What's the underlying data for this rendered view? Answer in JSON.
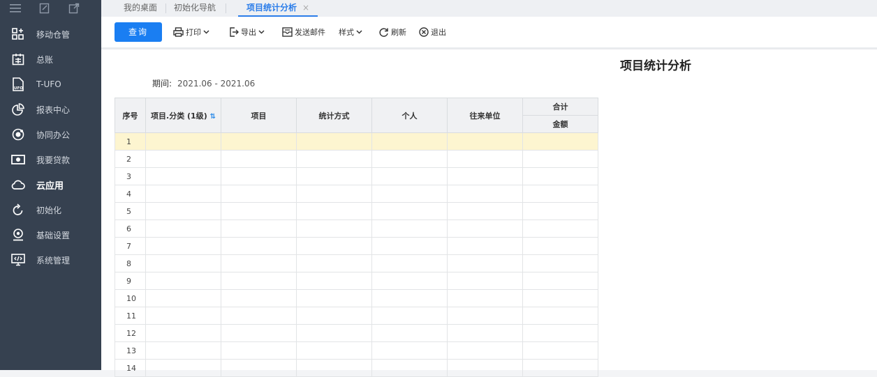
{
  "sidebar": {
    "top_icons": [
      "menu-icon",
      "compose-icon",
      "external-icon"
    ],
    "items": [
      {
        "label": "移动仓管",
        "icon": "warehouse-icon",
        "active": false
      },
      {
        "label": "总账",
        "icon": "ledger-icon",
        "active": false
      },
      {
        "label": "T-UFO",
        "icon": "ufo-file-icon",
        "active": false
      },
      {
        "label": "报表中心",
        "icon": "pie-chart-icon",
        "active": false
      },
      {
        "label": "协同办公",
        "icon": "collaboration-icon",
        "active": false
      },
      {
        "label": "我要贷款",
        "icon": "money-icon",
        "active": false
      },
      {
        "label": "云应用",
        "icon": "cloud-icon",
        "active": true
      },
      {
        "label": "初始化",
        "icon": "refresh-icon",
        "active": false
      },
      {
        "label": "基础设置",
        "icon": "settings-user-icon",
        "active": false
      },
      {
        "label": "系统管理",
        "icon": "system-monitor-icon",
        "active": false
      }
    ]
  },
  "tabs": [
    {
      "label": "我的桌面",
      "active": false
    },
    {
      "label": "初始化导航",
      "active": false
    },
    {
      "label": "项目统计分析",
      "active": true,
      "close": "×"
    }
  ],
  "toolbar": {
    "query": "查询",
    "print": "打印",
    "export": "导出",
    "send_mail": "发送邮件",
    "style": "样式",
    "refresh": "刷新",
    "exit": "退出"
  },
  "report": {
    "title": "项目统计分析",
    "period_label": "期间:",
    "period_value": "2021.06 - 2021.06"
  },
  "table": {
    "headers": {
      "seq": "序号",
      "category": "项目.分类 (1级)",
      "item": "项目",
      "method": "统计方式",
      "person": "个人",
      "partner": "往来单位",
      "total": "合计",
      "amount": "金额"
    },
    "rows": [
      "1",
      "2",
      "3",
      "4",
      "5",
      "6",
      "7",
      "8",
      "9",
      "10",
      "11",
      "12",
      "13",
      "14"
    ]
  },
  "colors": {
    "accent": "#1a7ef2",
    "sidebar": "#364150",
    "highlight_row": "#fdf5d0"
  }
}
